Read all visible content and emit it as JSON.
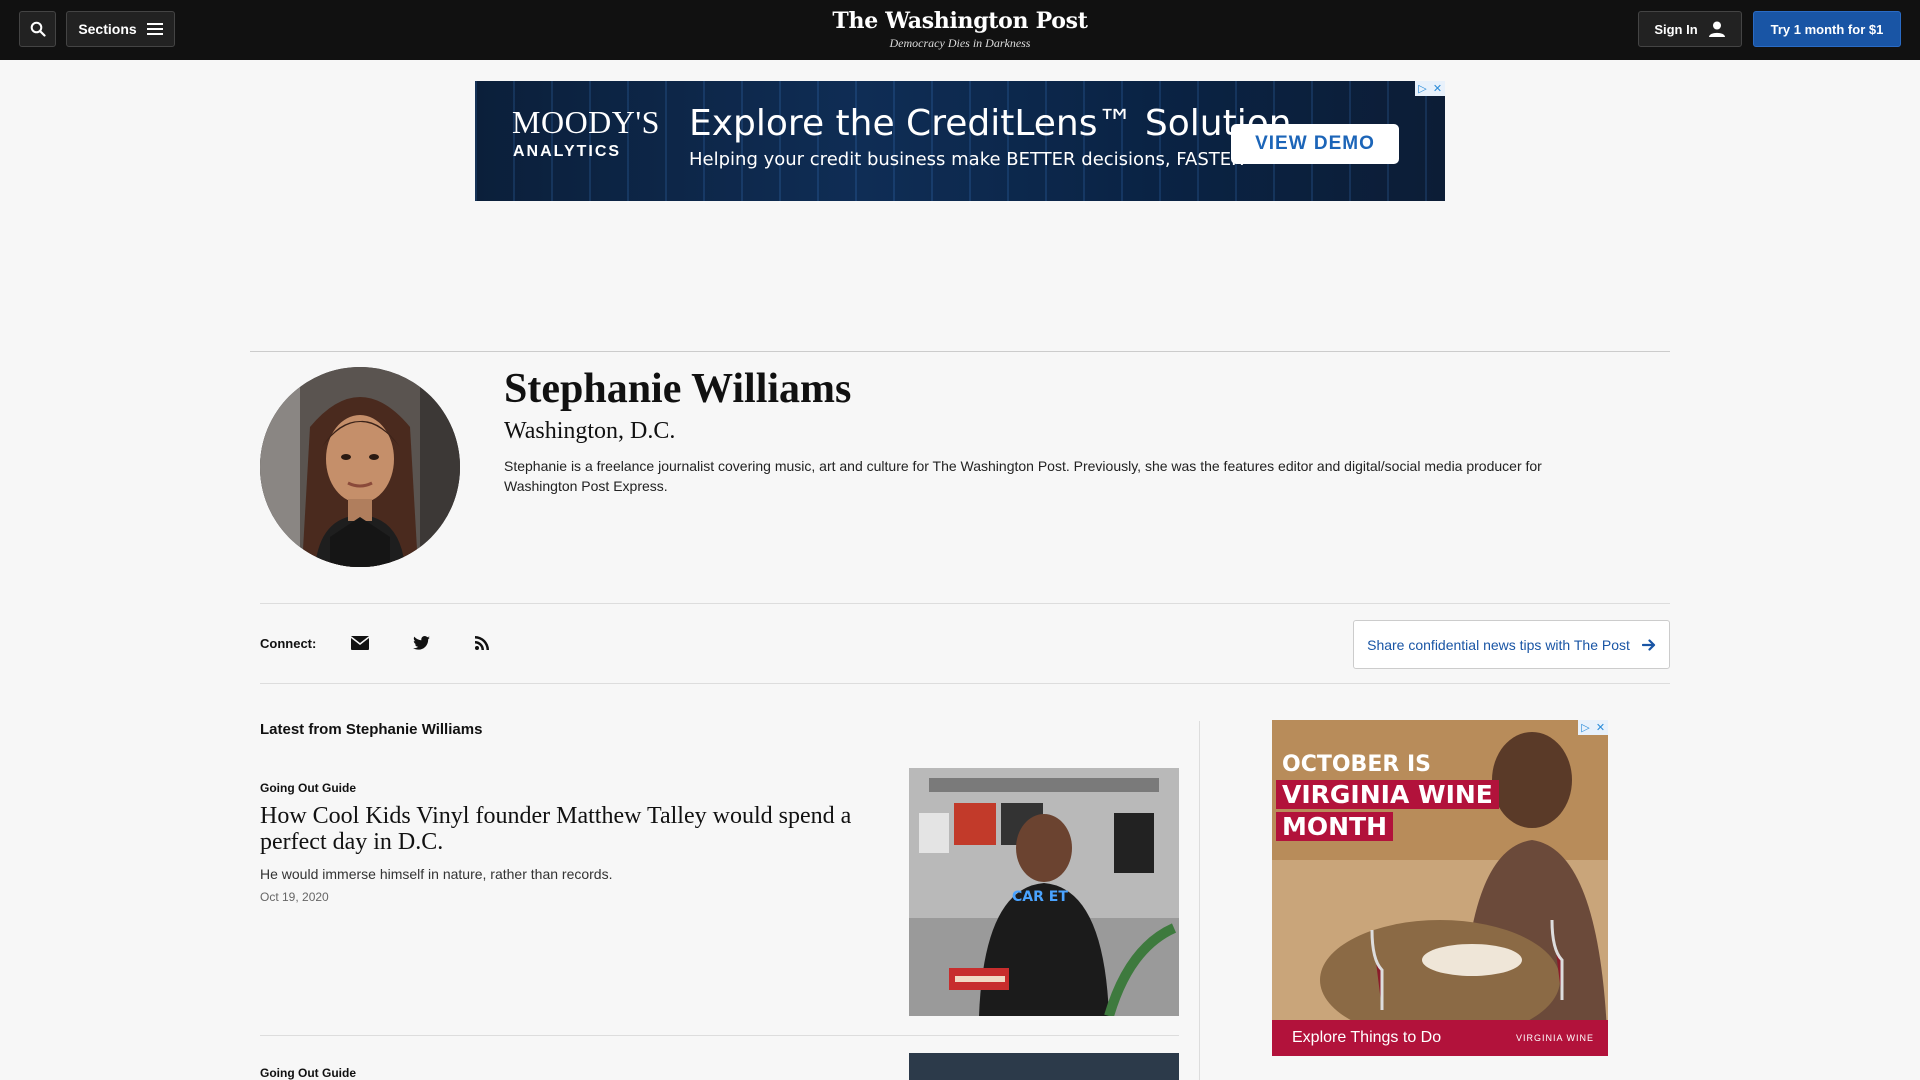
{
  "nav": {
    "sections_label": "Sections",
    "logo": "The Washington Post",
    "tagline": "Democracy Dies in Darkness",
    "signin_label": "Sign In",
    "trial_label": "Try 1 month for $1"
  },
  "ad_top": {
    "brand": "MOODY'S",
    "brand_sub": "ANALYTICS",
    "headline": "Explore the CreditLens™ Solution",
    "subline": "Helping your credit business make BETTER decisions, FASTER",
    "cta": "VIEW DEMO"
  },
  "author": {
    "name": "Stephanie Williams",
    "location": "Washington, D.C.",
    "bio": "Stephanie is a freelance journalist covering music, art and culture for The Washington Post. Previously, she was the features editor and digital/social media producer for Washington Post Express."
  },
  "connect": {
    "label": "Connect:",
    "icons": [
      "email-icon",
      "twitter-icon",
      "rss-icon"
    ],
    "tips_label": "Share confidential news tips with The Post"
  },
  "latest": {
    "title": "Latest from Stephanie Williams",
    "stories": [
      {
        "kicker": "Going Out Guide",
        "headline": "How Cool Kids Vinyl founder Matthew Talley would spend a perfect day in D.C.",
        "blurb": "He would immerse himself in nature, rather than records.",
        "date": "Oct 19, 2020",
        "shirt_text": "CAR ET"
      },
      {
        "kicker": "Going Out Guide"
      }
    ]
  },
  "ad_side": {
    "line1": "OCTOBER IS",
    "line2": "VIRGINIA WINE",
    "line3": "MONTH",
    "cta": "Explore Things to Do",
    "logo": "VIRGINIA WINE"
  },
  "colors": {
    "accent": "#1955a5",
    "nav_bg": "#111111",
    "page_bg": "#f7f7f7"
  }
}
